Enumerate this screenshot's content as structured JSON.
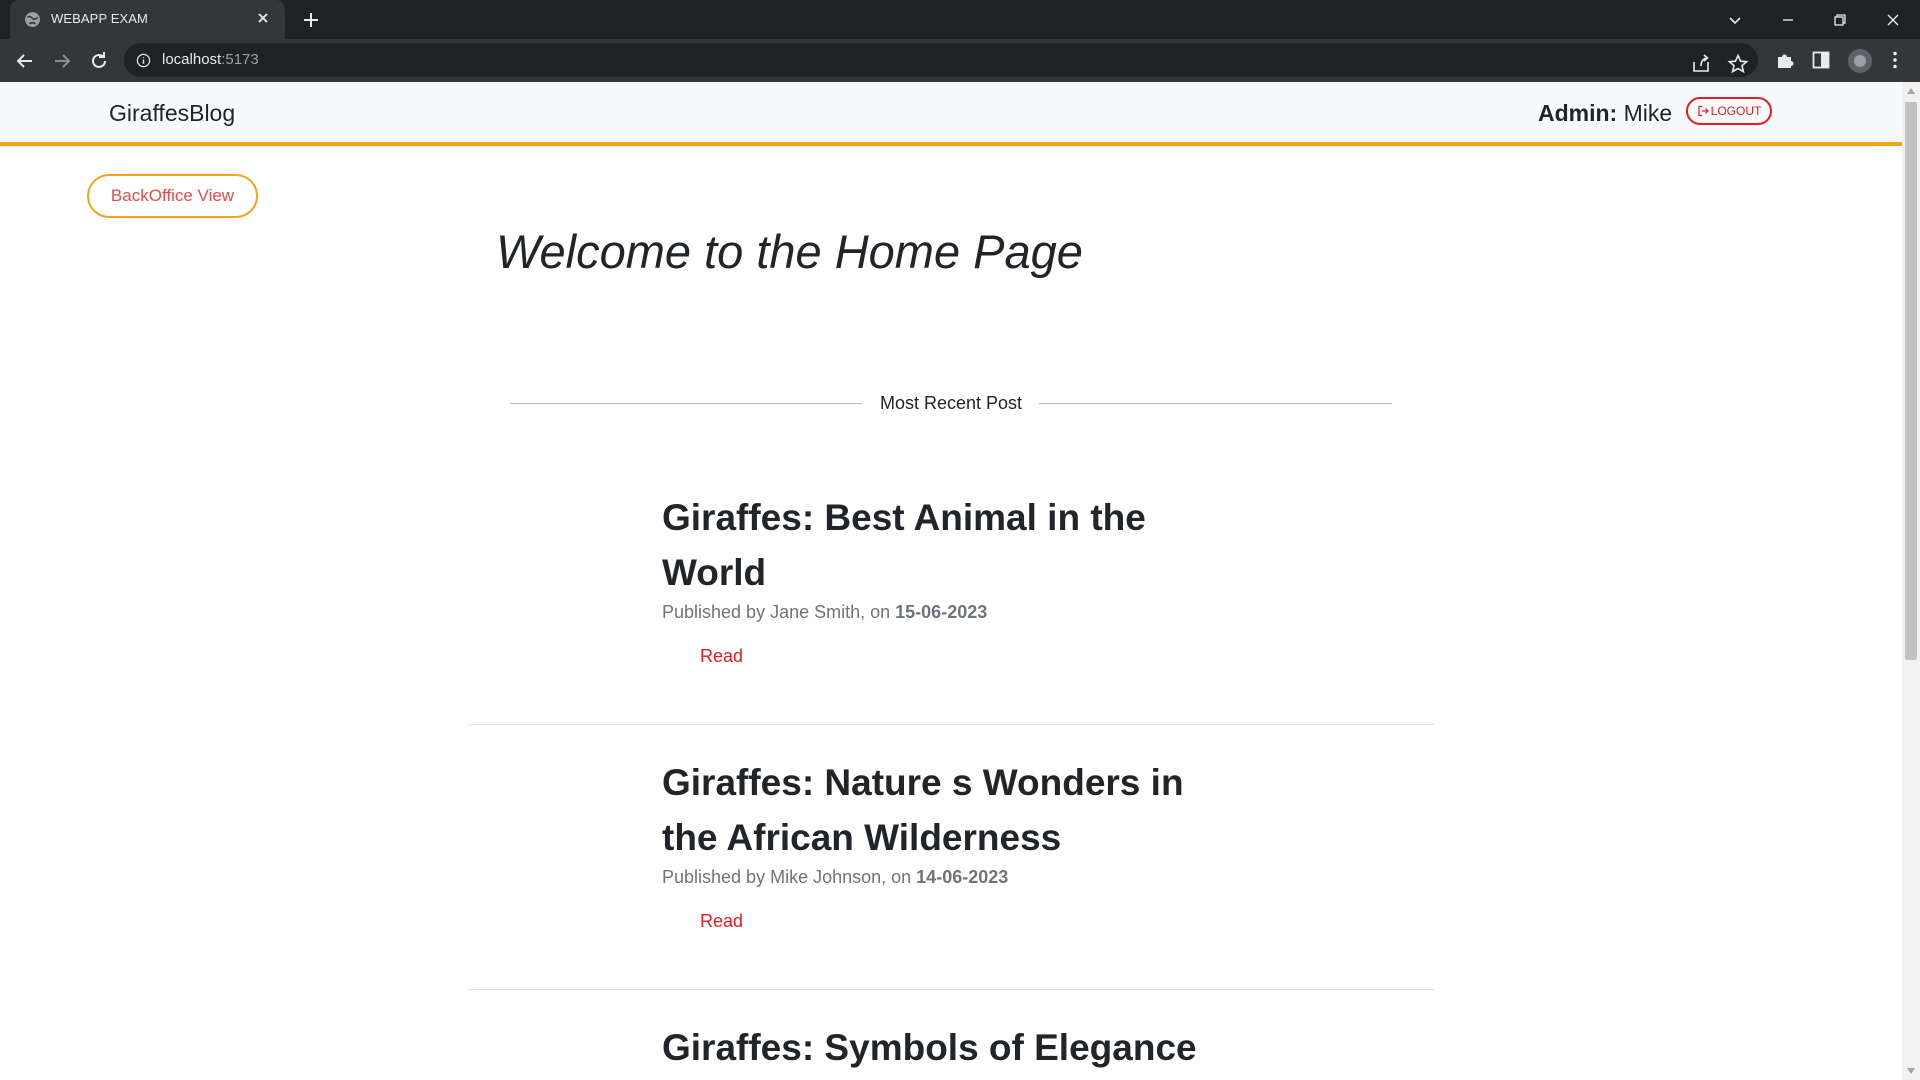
{
  "browser": {
    "tab_title": "WEBAPP EXAM",
    "url_host": "localhost",
    "url_port": ":5173"
  },
  "navbar": {
    "brand": "GiraffesBlog",
    "admin_label": "Admin:",
    "admin_name": "Mike",
    "logout_label": "LOGOUT",
    "accent_color": "#f5a31a"
  },
  "main": {
    "backoffice_button": "BackOffice View",
    "welcome_title": "Welcome to the Home Page",
    "section_label": "Most Recent Post",
    "posts": [
      {
        "title": "Giraffes: Best Animal in the World",
        "published_prefix": "Published by Jane Smith, on",
        "date": "15-06-2023",
        "read_label": "Read"
      },
      {
        "title": "Giraffes: Nature s Wonders in the African Wilderness",
        "published_prefix": "Published by Mike Johnson, on",
        "date": "14-06-2023",
        "read_label": "Read"
      },
      {
        "title": "Giraffes: Symbols of Elegance",
        "published_prefix": "",
        "date": "",
        "read_label": ""
      }
    ]
  },
  "icons": {
    "favicon": "globe-icon",
    "logout": "logout-icon"
  },
  "colors": {
    "link_red": "#e31b23",
    "chrome_dark": "#202124"
  }
}
